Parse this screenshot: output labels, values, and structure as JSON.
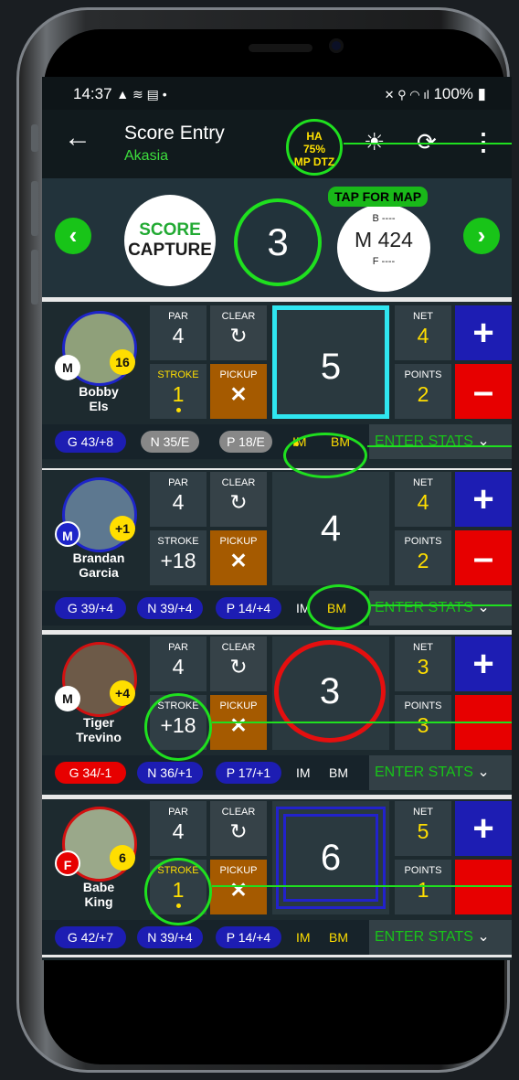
{
  "status": {
    "time": "14:37",
    "left_icons": "▲ ≋ ▤ •",
    "battery": "100%",
    "right_icons": "✕ ⚲ ◠ ıl"
  },
  "header": {
    "title": "Score Entry",
    "subtitle": "Akasia",
    "ha_lines": [
      "HA",
      "75%",
      "MP DTZ"
    ]
  },
  "hole": {
    "number": "3",
    "map_tag": "TAP FOR MAP",
    "back": "B ----",
    "middle": "M 424",
    "front": "F ----"
  },
  "logo": {
    "line1": "SCORE",
    "line2": "CAPTURE"
  },
  "labels": {
    "par": "PAR",
    "clear": "CLEAR",
    "stroke": "STROKE",
    "pickup": "PICKUP",
    "net": "NET",
    "points": "POINTS",
    "im": "IM",
    "bm": "BM",
    "enter_stats": "ENTER STATS"
  },
  "players": [
    {
      "first": "Bobby",
      "last": "Els",
      "badge_left": "M",
      "badge_right": "16",
      "par": "4",
      "stroke": "1",
      "score": "5",
      "net": "4",
      "points": "2",
      "g": "G 43/+8",
      "n": "N 35/E",
      "p": "P 18/E"
    },
    {
      "first": "Brandan",
      "last": "Garcia",
      "badge_left": "M",
      "badge_right": "+1",
      "par": "4",
      "stroke": "+18",
      "score": "4",
      "net": "4",
      "points": "2",
      "g": "G 39/+4",
      "n": "N 39/+4",
      "p": "P 14/+4"
    },
    {
      "first": "Tiger",
      "last": "Trevino",
      "badge_left": "M",
      "badge_right": "+4",
      "par": "4",
      "stroke": "+18",
      "score": "3",
      "net": "3",
      "points": "3",
      "g": "G 34/-1",
      "n": "N 36/+1",
      "p": "P 17/+1"
    },
    {
      "first": "Babe",
      "last": "King",
      "badge_left": "F",
      "badge_right": "6",
      "par": "4",
      "stroke": "1",
      "score": "6",
      "net": "5",
      "points": "1",
      "g": "G 42/+7",
      "n": "N 39/+4",
      "p": "P 14/+4"
    }
  ]
}
